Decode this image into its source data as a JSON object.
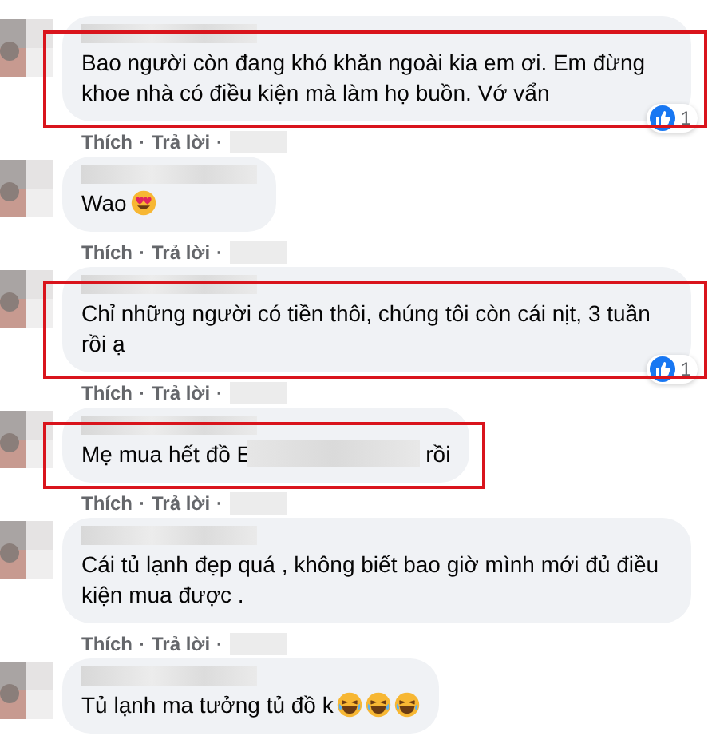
{
  "comments": [
    {
      "text_parts": [
        "Bao người còn đang khó khăn ngoài kia em ơi. Em đừng khoe nhà có điều kiện mà làm họ buồn. Vớ vẩn"
      ],
      "reactions": "1",
      "highlighted": true,
      "like": "Thích",
      "reply": "Trả lời",
      "separator": "·"
    },
    {
      "text_parts": [
        "Wao"
      ],
      "emoji": [
        {
          "kind": "heart-eyes"
        }
      ],
      "highlighted": false,
      "like": "Thích",
      "reply": "Trả lời",
      "separator": "·"
    },
    {
      "text_parts": [
        "Chỉ những người có tiền thôi, chúng tôi còn cái nịt, 3 tuần rồi ạ"
      ],
      "reactions": "1",
      "highlighted": true,
      "like": "Thích",
      "reply": "Trả lời",
      "separator": "·"
    },
    {
      "text_parts": [
        "Mẹ mua hết đồ E",
        "rồi"
      ],
      "highlighted": true,
      "like": "Thích",
      "reply": "Trả lời",
      "separator": "·"
    },
    {
      "text_parts": [
        "Cái tủ lạnh đẹp quá , không biết bao giờ mình mới đủ điều kiện mua được ."
      ],
      "highlighted": false,
      "like": "Thích",
      "reply": "Trả lời",
      "separator": "·"
    },
    {
      "text_parts": [
        "Tủ lạnh ma tưởng tủ đồ k"
      ],
      "emoji": [
        {
          "kind": "laughing"
        },
        {
          "kind": "laughing"
        },
        {
          "kind": "laughing"
        }
      ],
      "highlighted": false
    }
  ]
}
